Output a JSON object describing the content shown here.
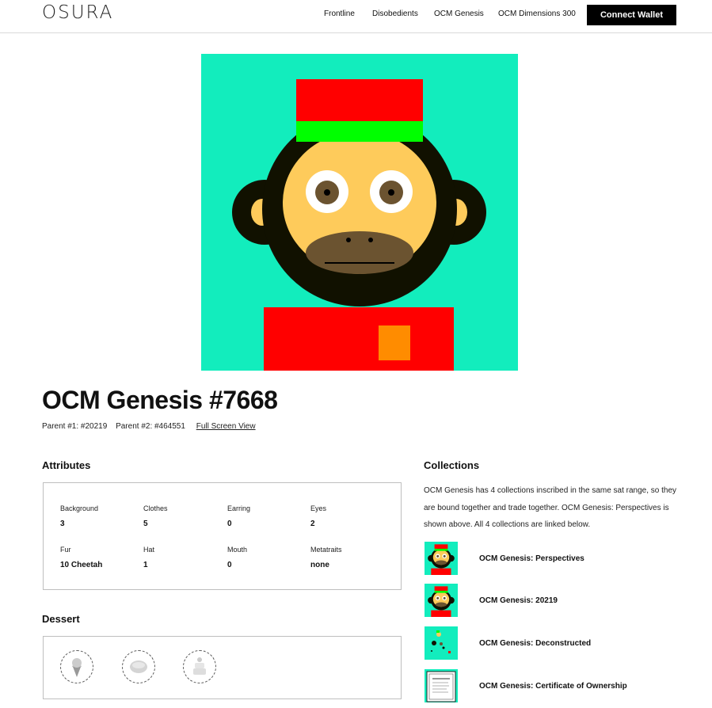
{
  "header": {
    "logo": "OSURA",
    "nav": [
      "Frontline",
      "Disobedients",
      "OCM Genesis",
      "OCM Dimensions 300"
    ],
    "connect_wallet": "Connect Wallet"
  },
  "hero": {
    "icon": "monkey-avatar-image",
    "colors": {
      "background": "#12EDBD",
      "hat_top": "#FF0000",
      "hat_band": "#00FF00",
      "fur": "#111100",
      "face": "#FECB5B",
      "muzzle": "#6B5330",
      "shirt": "#FF0000",
      "pocket": "#FF8C00"
    }
  },
  "title": "OCM Genesis #7668",
  "parents": {
    "parent1": "Parent #1: #20219",
    "parent2": "Parent #2: #464551",
    "fullscreen": "Full Screen View"
  },
  "attributes": {
    "heading": "Attributes",
    "items": [
      {
        "label": "Background",
        "value": "3"
      },
      {
        "label": "Clothes",
        "value": "5"
      },
      {
        "label": "Earring",
        "value": "0"
      },
      {
        "label": "Eyes",
        "value": "2"
      },
      {
        "label": "Fur",
        "value": "10 Cheetah"
      },
      {
        "label": "Hat",
        "value": "1"
      },
      {
        "label": "Mouth",
        "value": "0"
      },
      {
        "label": "Metatraits",
        "value": "none"
      }
    ]
  },
  "dessert": {
    "heading": "Dessert",
    "items": [
      {
        "icon": "ice-cream-icon"
      },
      {
        "icon": "cookie-icon"
      },
      {
        "icon": "cake-icon"
      }
    ]
  },
  "collections": {
    "heading": "Collections",
    "description": "OCM Genesis has 4 collections inscribed in the same sat range, so they are bound together and trade together. OCM Genesis: Perspectives is shown above. All 4 collections are linked below.",
    "items": [
      {
        "label": "OCM Genesis: Perspectives",
        "thumb": "monkey-thumbnail"
      },
      {
        "label": "OCM Genesis: 20219",
        "thumb": "monkey-thumbnail"
      },
      {
        "label": "OCM Genesis: Deconstructed",
        "thumb": "deconstructed-thumbnail"
      },
      {
        "label": "OCM Genesis: Certificate of Ownership",
        "thumb": "certificate-thumbnail"
      }
    ]
  }
}
